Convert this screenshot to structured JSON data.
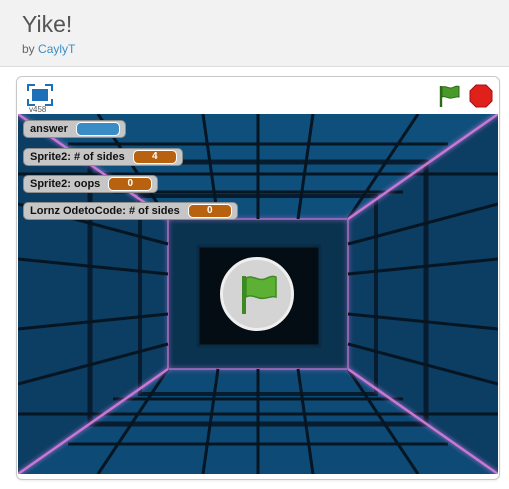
{
  "project": {
    "title": "Yike!",
    "by_label": "by",
    "author": "CaylyT"
  },
  "player": {
    "version": "v458",
    "icons": {
      "fullscreen": "fullscreen-icon",
      "green_flag": "green-flag-icon",
      "stop": "stop-icon",
      "start_overlay": "green-flag-icon"
    },
    "colors": {
      "green_flag": "#4a9a2a",
      "stop": "#e0201b",
      "fullscreen": "#1d6fb8",
      "monitor_value": "#b8620f",
      "answer_value": "#3a8cc6",
      "tunnel_glow": "#c778d6"
    }
  },
  "monitors": [
    {
      "label": "answer",
      "value": ""
    },
    {
      "label": "Sprite2: # of sides",
      "value": "4"
    },
    {
      "label": "Sprite2: oops",
      "value": "0"
    },
    {
      "label": "Lornz OdetoCode: # of sides",
      "value": "0"
    }
  ]
}
